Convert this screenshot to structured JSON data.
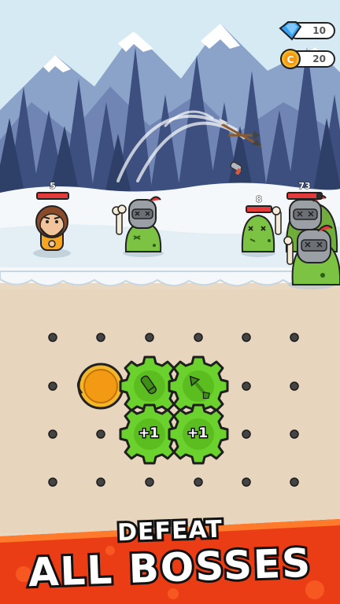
{
  "hud": {
    "gems": "10",
    "coins": "20",
    "gem_icon": "blue-gem-icon",
    "coin_icon": "gold-coin-icon"
  },
  "player": {
    "hp_text": "5",
    "hp_fraction": 1.0
  },
  "enemies": [
    {
      "id": "armored-zombie",
      "hp_fraction": 1.0
    },
    {
      "id": "small-zombie",
      "hp_text": "8",
      "hp_fraction": 1.0
    },
    {
      "id": "boss-zombie",
      "hp_text": "73",
      "hp_fraction": 0.85
    }
  ],
  "board": {
    "gear_labels": [
      "+1",
      "+1"
    ],
    "pieces": [
      "gold-coin-slot",
      "bullet-gear",
      "arrow-gear",
      "plus-one-gear",
      "plus-one-gear"
    ]
  },
  "banner": {
    "line1": "DEFEAT",
    "line2": "ALL BOSSES",
    "colors": {
      "bg": "#ea3d15",
      "accent": "#ff7a2a"
    }
  }
}
